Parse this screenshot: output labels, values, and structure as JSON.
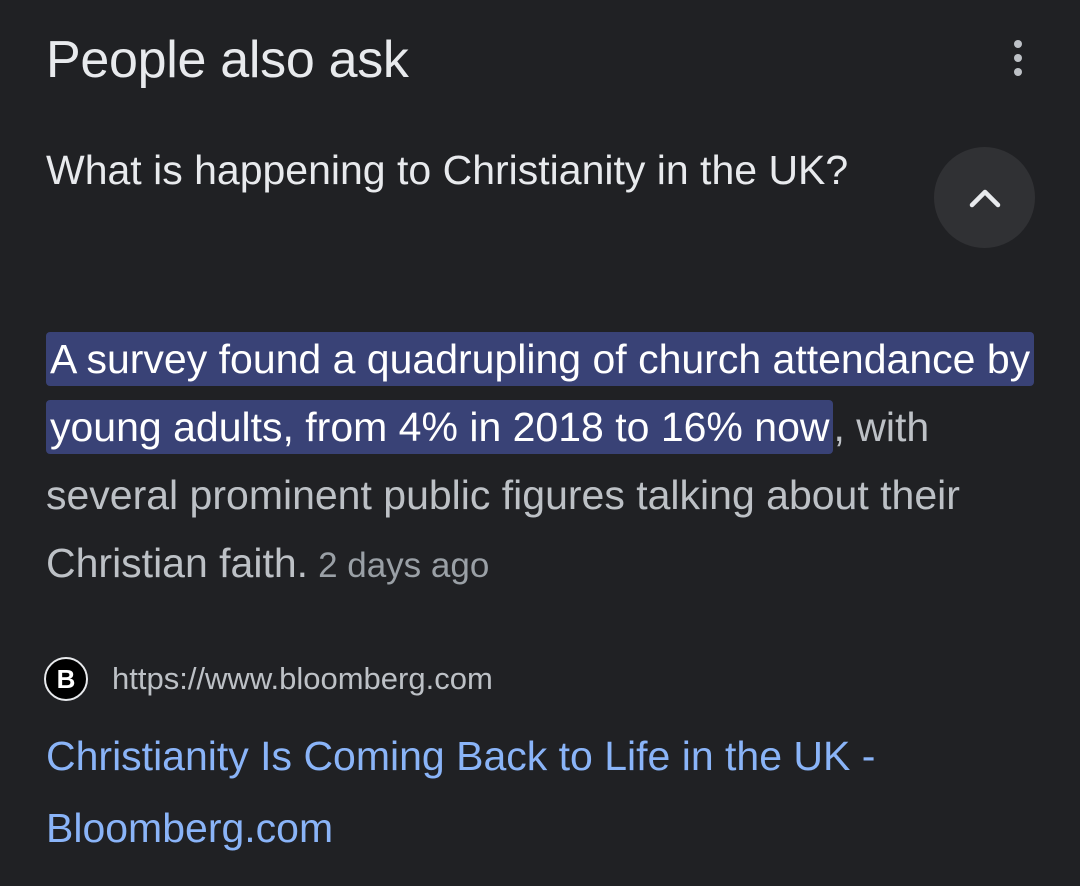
{
  "header": {
    "title": "People also ask",
    "menu_icon": "more-vert-icon"
  },
  "question": {
    "text": "What is happening to Christianity in the UK?",
    "toggle_icon": "chevron-up-icon"
  },
  "answer": {
    "highlighted": "A survey found a quadrupling of church attendance by young adults, from 4% in 2018 to 16% now",
    "rest": ", with several prominent public figures talking about their Christian faith.",
    "date": "2 days ago"
  },
  "source": {
    "favicon_letter": "B",
    "url": "https://www.bloomberg.com"
  },
  "result": {
    "title": "Christianity Is Coming Back to Life in the UK - Bloomberg.com"
  },
  "colors": {
    "background": "#202124",
    "highlight": "#394276",
    "link": "#8ab4f8"
  }
}
